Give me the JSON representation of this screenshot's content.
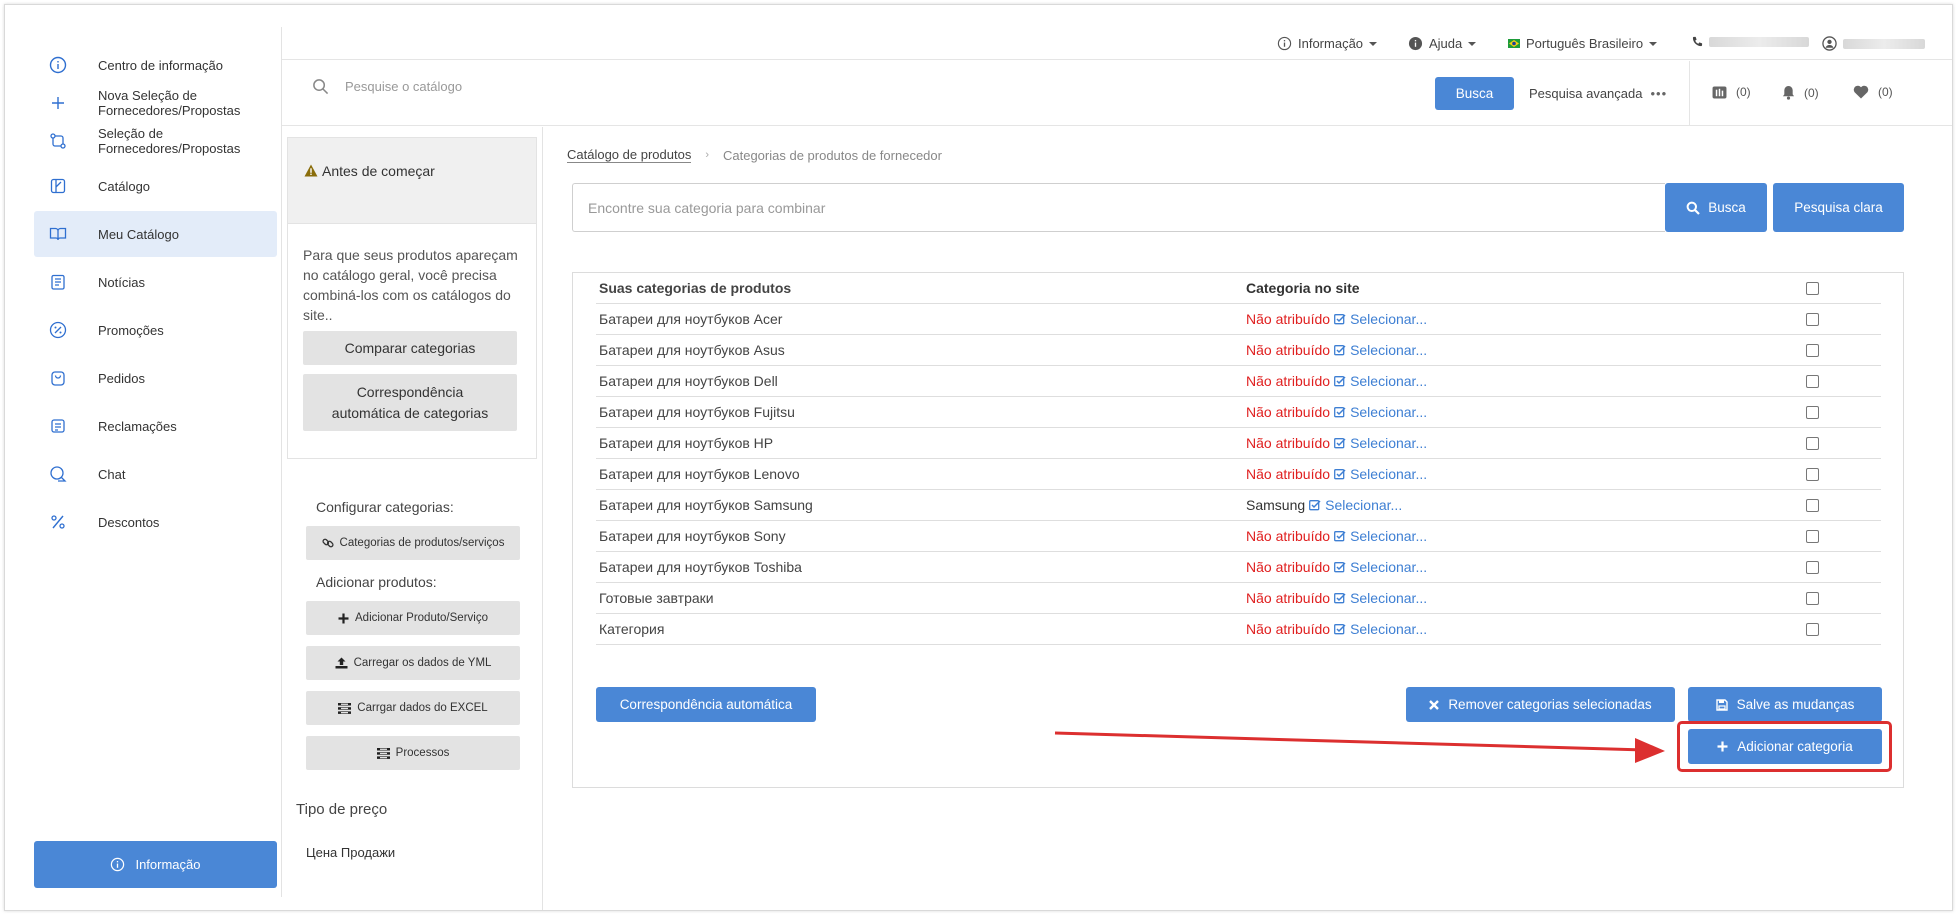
{
  "nav": {
    "items": [
      {
        "label": "Centro de informação",
        "icon": "info-circle-icon"
      },
      {
        "label": "Nova Seleção de Fornecedores/Propostas",
        "icon": "plus-icon"
      },
      {
        "label": "Seleção de Fornecedores/Propostas",
        "icon": "swap-icon"
      },
      {
        "label": "Catálogo",
        "icon": "catalog-icon"
      },
      {
        "label": "Meu Catálogo",
        "icon": "open-book-icon"
      },
      {
        "label": "Notícias",
        "icon": "news-icon"
      },
      {
        "label": "Promoções",
        "icon": "percent-badge-icon"
      },
      {
        "label": "Pedidos",
        "icon": "bag-icon"
      },
      {
        "label": "Reclamações",
        "icon": "complaint-icon"
      },
      {
        "label": "Chat",
        "icon": "chat-icon"
      },
      {
        "label": "Descontos",
        "icon": "percent-icon"
      }
    ],
    "active_index": 4,
    "info_button": "Informação"
  },
  "topbar": {
    "info": "Informação",
    "help": "Ajuda",
    "language": "Português Brasileiro"
  },
  "search": {
    "placeholder": "Pesquise o catálogo",
    "button": "Busca",
    "advanced": "Pesquisa avançada",
    "compare_count": "(0)",
    "notify_count": "(0)",
    "fav_count": "(0)"
  },
  "left_panel": {
    "warning_title": "Antes de começar",
    "warning_text": "Para que seus produtos apareçam no catálogo geral, você precisa combiná-los com os catálogos do site..",
    "compare_btn": "Comparar categorias",
    "auto_match_btn": "Correspondência automática de categorias",
    "configure_heading": "Configurar categorias:",
    "categories_btn": "Categorias de produtos/serviços",
    "add_heading": "Adicionar produtos:",
    "add_product_btn": "Adicionar Produto/Serviço",
    "yml_btn": "Carregar os dados de YML",
    "excel_btn": "Carrgar dados do EXCEL",
    "processes_btn": "Processos",
    "price_type_heading": "Tipo de preço",
    "price_type_value": "Цена Продажи"
  },
  "breadcrumb": {
    "root": "Catálogo de produtos",
    "current": "Categorias de produtos de fornecedor"
  },
  "category_search": {
    "placeholder": "Encontre sua categoria para combinar",
    "search_btn": "Busca",
    "clear_btn": "Pesquisa clara"
  },
  "table": {
    "col_name": "Suas categorias de produtos",
    "col_site": "Categoria no site",
    "select_label": "Selecionar...",
    "rows": [
      {
        "name": "Батареи для ноутбуков Acer",
        "site": "Não atribuído",
        "assigned": false
      },
      {
        "name": "Батареи для ноутбуков Asus",
        "site": "Não atribuído",
        "assigned": false
      },
      {
        "name": "Батареи для ноутбуков Dell",
        "site": "Não atribuído",
        "assigned": false
      },
      {
        "name": "Батареи для ноутбуков Fujitsu",
        "site": "Não atribuído",
        "assigned": false
      },
      {
        "name": "Батареи для ноутбуков HP",
        "site": "Não atribuído",
        "assigned": false
      },
      {
        "name": "Батареи для ноутбуков Lenovo",
        "site": "Não atribuído",
        "assigned": false
      },
      {
        "name": "Батареи для ноутбуков Samsung",
        "site": "Samsung",
        "assigned": true
      },
      {
        "name": "Батареи для ноутбуков Sony",
        "site": "Não atribuído",
        "assigned": false
      },
      {
        "name": "Батареи для ноутбуков Toshiba",
        "site": "Não atribuído",
        "assigned": false
      },
      {
        "name": "Готовые завтраки",
        "site": "Não atribuído",
        "assigned": false
      },
      {
        "name": "Категория",
        "site": "Não atribuído",
        "assigned": false
      }
    ]
  },
  "actions": {
    "auto_match": "Correspondência automática",
    "remove_selected": "Remover categorias selecionadas",
    "save": "Salve as mudanças",
    "add_category": "Adicionar categoria"
  },
  "colors": {
    "accent": "#4a87d6",
    "unassigned": "#e02020",
    "highlight": "#dc2f2f"
  }
}
